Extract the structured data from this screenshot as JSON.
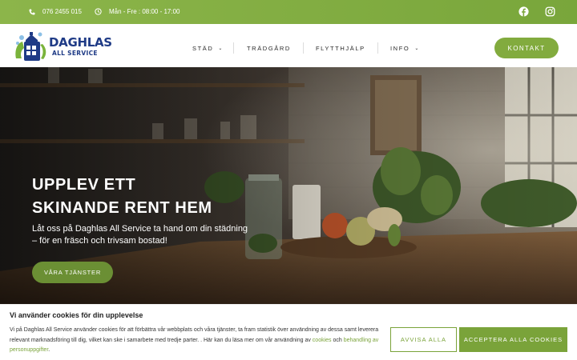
{
  "topbar": {
    "phone": "076 2455 015",
    "hours": "Mån - Fre : 08:00 - 17:00",
    "icons": {
      "phone": "phone-icon",
      "clock": "clock-icon",
      "facebook": "facebook-icon",
      "instagram": "instagram-icon"
    }
  },
  "logo": {
    "name": "DAGHLAS",
    "sub": "ALL SERVICE"
  },
  "nav": {
    "items": [
      {
        "label": "STÄD",
        "has_dropdown": true
      },
      {
        "label": "TRÄDGÅRD",
        "has_dropdown": false
      },
      {
        "label": "FLYTTHJÄLP",
        "has_dropdown": false
      },
      {
        "label": "INFO",
        "has_dropdown": true
      }
    ],
    "chevron": "⌄",
    "contact_label": "KONTAKT"
  },
  "hero": {
    "title_line1": "UPPLEV ETT",
    "title_line2": "SKINANDE RENT HEM",
    "text": "Låt oss på Daghlas All Service ta hand om din städning – för en fräsch och trivsam bostad!",
    "button_label": "VÅRA TJÄNSTER"
  },
  "cookie": {
    "title": "Vi använder cookies för din upplevelse",
    "text_start": "Vi på Daghlas All Service använder cookies för att förbättra vår webbplats och våra tjänster, ta fram statistik över användning av dessa samt leverera relevant marknadsföring till dig, vilket kan ske i samarbete med tredje parter. . Här kan du läsa mer om vår användning av ",
    "link_cookies": "cookies",
    "text_mid": " och ",
    "link_personal": "behandling av personuppgifter",
    "text_end": ".",
    "reject_label": "AVVISA ALLA",
    "accept_label": "ACCEPTERA ALLA COOKIES"
  },
  "colors": {
    "green": "#7aa33a",
    "navy": "#1f3b86"
  }
}
